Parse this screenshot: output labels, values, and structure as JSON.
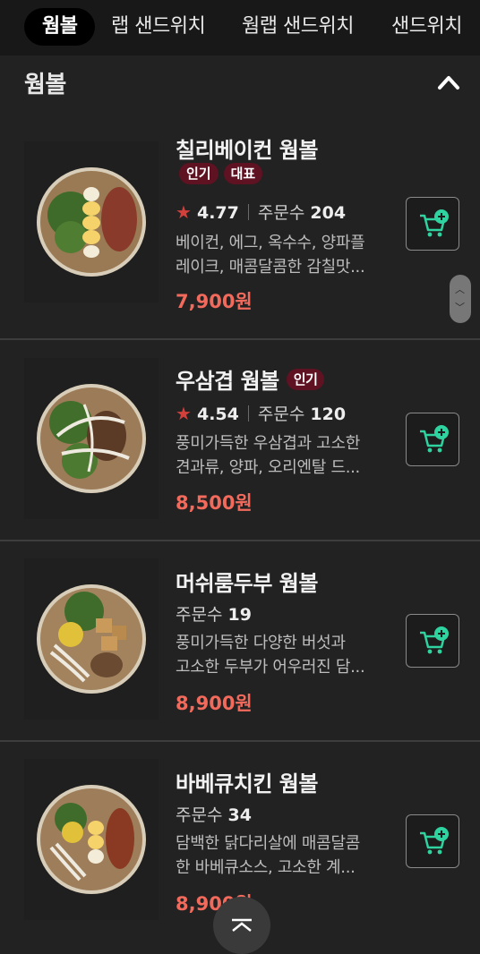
{
  "tabs": [
    {
      "label": "웜볼",
      "active": true
    },
    {
      "label": "랩 샌드위치",
      "active": false
    },
    {
      "label": "웜랩 샌드위치",
      "active": false
    },
    {
      "label": "샌드위치",
      "active": false
    }
  ],
  "section": {
    "title": "웜볼",
    "toggle_icon": "chevron-up-icon"
  },
  "items": [
    {
      "name": "칠리베이컨 웜볼",
      "badges": [
        "인기",
        "대표"
      ],
      "rating": "4.77",
      "orders_label": "주문수",
      "orders": "204",
      "desc_line1": "베이컨, 에그, 옥수수, 양파플",
      "desc_line2": "레이크, 매콤달콤한 감칠맛...",
      "price": "7,900원"
    },
    {
      "name": "우삼겹 웜볼",
      "badges": [
        "인기"
      ],
      "rating": "4.54",
      "orders_label": "주문수",
      "orders": "120",
      "desc_line1": "풍미가득한 우삼겹과 고소한",
      "desc_line2": "견과류, 양파, 오리엔탈 드...",
      "price": "8,500원"
    },
    {
      "name": "머쉬룸두부 웜볼",
      "badges": [],
      "orders_label": "주문수",
      "orders": "19",
      "desc_line1": "풍미가득한 다양한 버섯과",
      "desc_line2": "고소한 두부가 어우러진 담...",
      "price": "8,900원"
    },
    {
      "name": "바베큐치킨 웜볼",
      "badges": [],
      "orders_label": "주문수",
      "orders": "34",
      "desc_line1": "담백한 닭다리살에 매콤달콤",
      "desc_line2": "한 바베큐소스, 고소한 계...",
      "price": "8,900원"
    }
  ],
  "colors": {
    "price": "#f26a5c",
    "badge": "#5e1222",
    "cart_accent": "#2fd3a0",
    "star": "#d2403c"
  }
}
